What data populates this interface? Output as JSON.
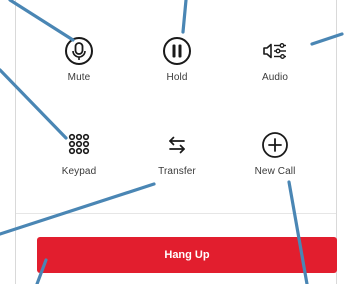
{
  "controls": {
    "mute": "Mute",
    "hold": "Hold",
    "audio": "Audio",
    "keypad": "Keypad",
    "transfer": "Transfer",
    "new_call": "New Call"
  },
  "hangup": {
    "label": "Hang Up"
  },
  "colors": {
    "accent_red": "#e21e2e",
    "callout_blue": "#4a86b4",
    "icon_dark": "#1a1a1a"
  },
  "icons": {
    "mute": "microphone-icon",
    "hold": "pause-circle-icon",
    "audio": "audio-settings-icon",
    "keypad": "keypad-grid-icon",
    "transfer": "transfer-arrows-icon",
    "new_call": "plus-circle-icon"
  }
}
